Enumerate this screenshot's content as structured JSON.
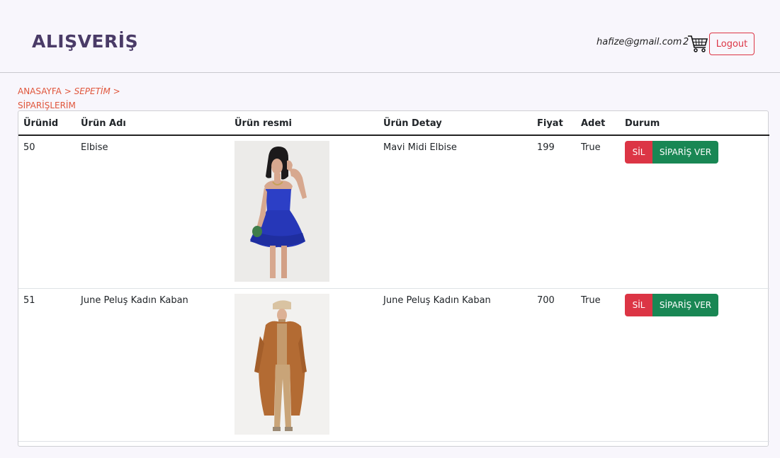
{
  "header": {
    "brand": "ALIŞVERİŞ",
    "user_email": "hafize@gmail.com",
    "cart_count": "2",
    "logout_label": "Logout"
  },
  "breadcrumb": {
    "home": "ANASAYFA",
    "sep1": ">",
    "cart": "SEPETİM",
    "sep2": ">",
    "orders": "SİPARİŞLERİM"
  },
  "table": {
    "columns": [
      "Ürünid",
      "Ürün Adı",
      "Ürün resmi",
      "Ürün Detay",
      "Fiyat",
      "Adet",
      "Durum"
    ],
    "rows": [
      {
        "id": "50",
        "name": "Elbise",
        "image": "blue-dress-product-image",
        "detail": "Mavi Midi Elbise",
        "price": "199",
        "qty": "True",
        "delete_label": "SİL",
        "order_label": "SİPARİŞ VER"
      },
      {
        "id": "51",
        "name": "June Peluş Kadın Kaban",
        "image": "brown-coat-product-image",
        "detail": "June Peluş Kadın Kaban",
        "price": "700",
        "qty": "True",
        "delete_label": "SİL",
        "order_label": "SİPARİŞ VER"
      }
    ]
  },
  "colors": {
    "danger": "#dc3545",
    "success": "#198754",
    "brand": "#4a3b67",
    "breadcrumb": "#e0553b"
  }
}
